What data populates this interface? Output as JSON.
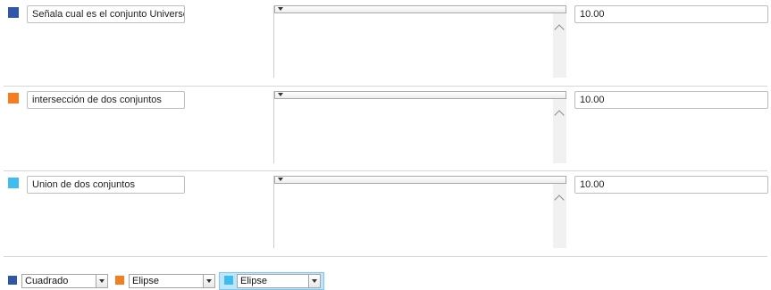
{
  "rows": [
    {
      "color": "#2f56a8",
      "label": "Señala cual es el conjunto Universo",
      "value": "10.00"
    },
    {
      "color": "#f57c1f",
      "label": "intersección de dos conjuntos",
      "value": "10.00"
    },
    {
      "color": "#3fbdf0",
      "label": "Union de dos conjuntos",
      "value": "10.00"
    }
  ],
  "shapes": [
    {
      "color": "#2f56a8",
      "selected": "Cuadrado",
      "icon": "chevron-down-icon"
    },
    {
      "color": "#f57c1f",
      "selected": "Elipse",
      "icon": "chevron-down-icon"
    },
    {
      "color": "#3fbdf0",
      "selected": "Elipse",
      "icon": "chevron-down-icon",
      "highlighted": true
    }
  ]
}
